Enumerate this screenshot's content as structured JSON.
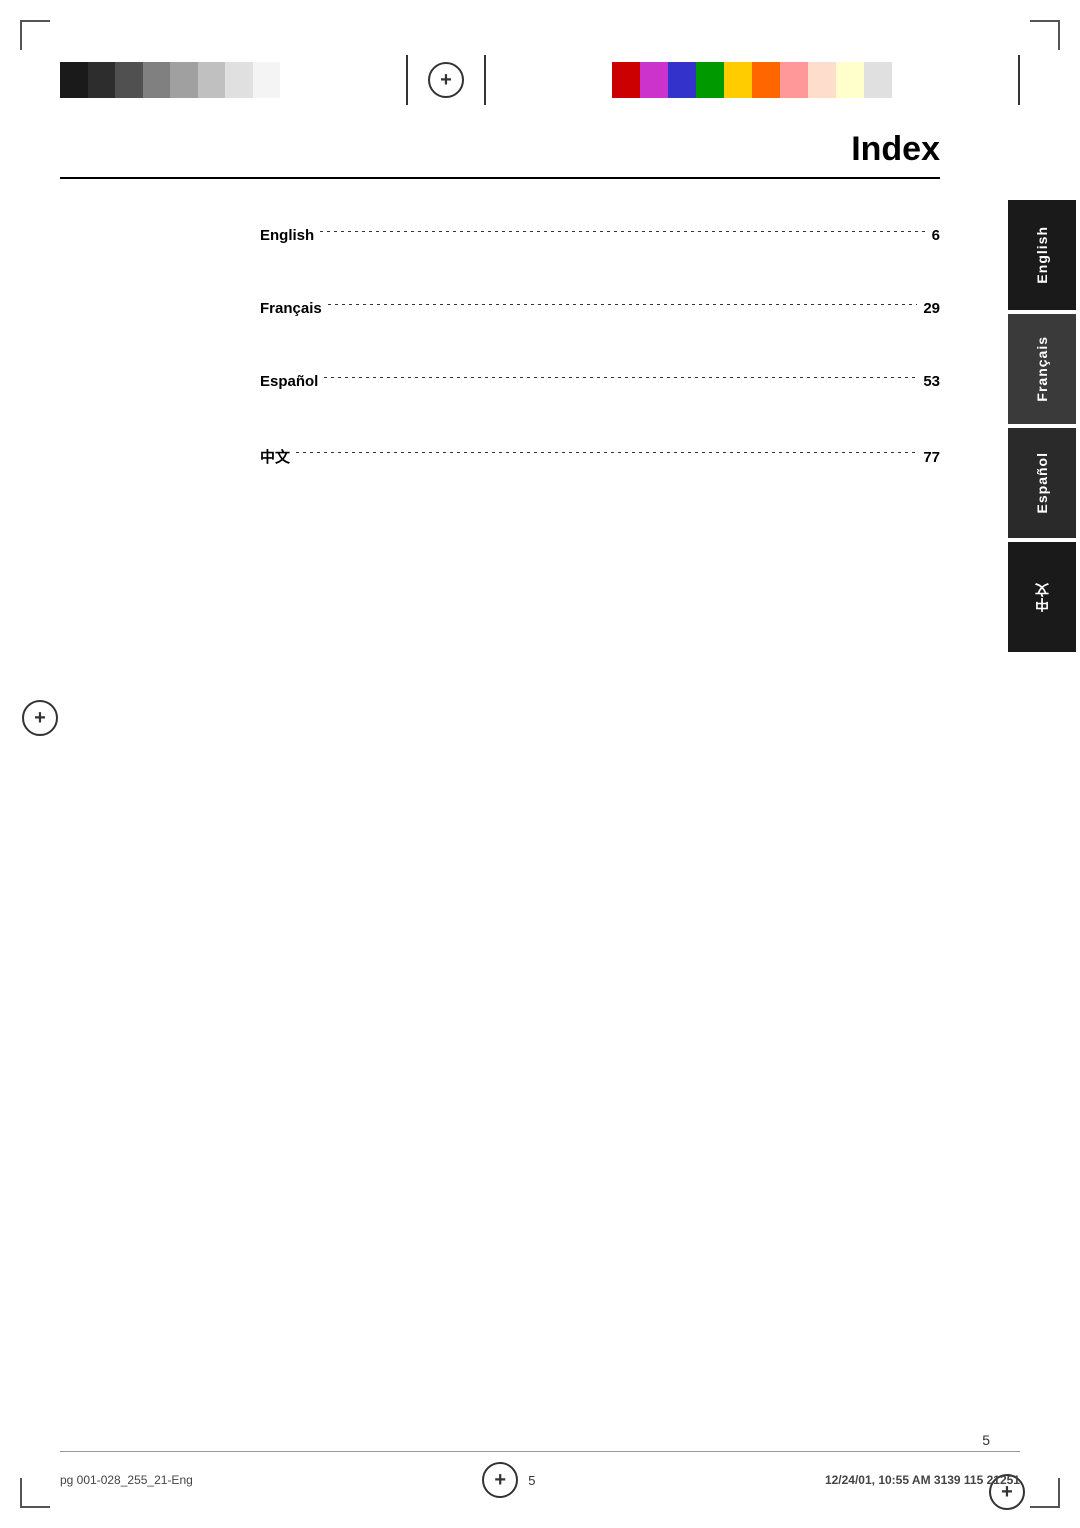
{
  "page": {
    "title": "Index",
    "page_number": "5"
  },
  "color_strips": {
    "left": [
      {
        "color": "#1a1a1a"
      },
      {
        "color": "#2a2a2a"
      },
      {
        "color": "#555555"
      },
      {
        "color": "#888888"
      },
      {
        "color": "#aaaaaa"
      },
      {
        "color": "#cccccc"
      },
      {
        "color": "#e0e0e0"
      },
      {
        "color": "#f5f5f5"
      }
    ],
    "right": [
      {
        "color": "#cc3300"
      },
      {
        "color": "#ff6600"
      },
      {
        "color": "#ffcc00"
      },
      {
        "color": "#009933"
      },
      {
        "color": "#0066cc"
      },
      {
        "color": "#6600cc"
      },
      {
        "color": "#cc0066"
      },
      {
        "color": "#ff99cc"
      },
      {
        "color": "#ffcccc"
      },
      {
        "color": "#ffffcc"
      }
    ]
  },
  "toc": {
    "entries": [
      {
        "label": "English",
        "dots": true,
        "page": "6"
      },
      {
        "label": "Français",
        "dots": true,
        "page": "29"
      },
      {
        "label": "Español",
        "dots": true,
        "page": "53"
      },
      {
        "label": "中文",
        "dots": true,
        "page": "77"
      }
    ]
  },
  "tabs": [
    {
      "label": "English",
      "color": "#1a1a1a"
    },
    {
      "label": "Français",
      "color": "#3a3a3a"
    },
    {
      "label": "Español",
      "color": "#2a2a2a"
    },
    {
      "label": "中文",
      "color": "#1a1a1a"
    }
  ],
  "footer": {
    "left": "pg 001-028_255_21-Eng",
    "center": "5",
    "right": "12/24/01, 10:55 AM  3139 115 21251"
  }
}
